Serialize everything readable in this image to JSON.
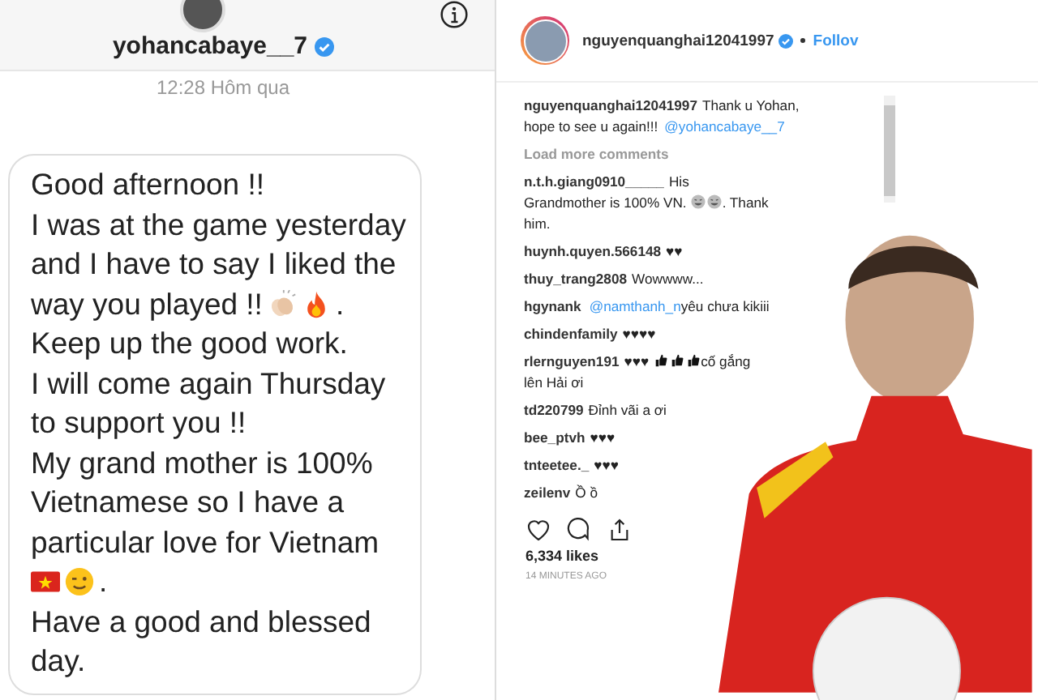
{
  "dm": {
    "username": "yohancabaye__7",
    "verified": true,
    "time": "12:28 Hôm qua",
    "message_lines": [
      [
        {
          "kind": "text",
          "text": "Good afternoon !!"
        }
      ],
      [
        {
          "kind": "text",
          "text": "I was at the game yesterday"
        }
      ],
      [
        {
          "kind": "text",
          "text": "and I have to say I liked the"
        }
      ],
      [
        {
          "kind": "text",
          "text": "way you played !!"
        },
        {
          "kind": "clap"
        },
        {
          "kind": "fire"
        },
        {
          "kind": "text",
          "text": "."
        }
      ],
      [
        {
          "kind": "text",
          "text": "Keep up the good work."
        }
      ],
      [
        {
          "kind": "text",
          "text": "I will come again Thursday"
        }
      ],
      [
        {
          "kind": "text",
          "text": "to support you !!"
        }
      ],
      [
        {
          "kind": "text",
          "text": "My grand mother is 100%"
        }
      ],
      [
        {
          "kind": "text",
          "text": "Vietnamese so I have a"
        }
      ],
      [
        {
          "kind": "text",
          "text": "particular love for Vietnam"
        }
      ],
      [
        {
          "kind": "flag"
        },
        {
          "kind": "wink"
        },
        {
          "kind": "text",
          "text": "."
        }
      ],
      [
        {
          "kind": "text",
          "text": "Have a good and blessed"
        }
      ],
      [
        {
          "kind": "text",
          "text": "day."
        }
      ]
    ]
  },
  "post": {
    "username": "nguyenquanghai12041997",
    "verified": true,
    "follow": "Follov",
    "comments": [
      {
        "user": "nguyenquanghai12041997",
        "parts": [
          {
            "kind": "text",
            "text": "Thank u Yohan,"
          },
          {
            "kind": "break"
          },
          {
            "kind": "text",
            "text": "hope to see u again!!!"
          },
          {
            "kind": "mention",
            "text": "@yohancabaye__7"
          }
        ]
      },
      {
        "kind": "load",
        "text": "Load more comments"
      },
      {
        "user": "n.t.h.giang0910_____",
        "parts": [
          {
            "kind": "text",
            "text": "His"
          },
          {
            "kind": "break"
          },
          {
            "kind": "text",
            "text": "Grandmother is 100% VN."
          },
          {
            "kind": "laugh"
          },
          {
            "kind": "laugh"
          },
          {
            "kind": "text",
            "text": ". Thank"
          },
          {
            "kind": "break"
          },
          {
            "kind": "text",
            "text": "him."
          }
        ]
      },
      {
        "user": "huynh.quyen.566148",
        "parts": [
          {
            "kind": "text",
            "text": "♥♥"
          }
        ]
      },
      {
        "user": "thuy_trang2808",
        "parts": [
          {
            "kind": "text",
            "text": "Wowwww..."
          }
        ]
      },
      {
        "user": "hgynank",
        "parts": [
          {
            "kind": "mention",
            "text": "@namthanh_n"
          },
          {
            "kind": "text",
            "text": "yêu chưa kikiii"
          }
        ]
      },
      {
        "user": "chindenfamily",
        "parts": [
          {
            "kind": "text",
            "text": "♥♥♥♥"
          }
        ]
      },
      {
        "user": "rlernguyen191",
        "parts": [
          {
            "kind": "text",
            "text": "♥♥♥"
          },
          {
            "kind": "thumb"
          },
          {
            "kind": "thumb"
          },
          {
            "kind": "thumb"
          },
          {
            "kind": "text",
            "text": "cố gắng"
          },
          {
            "kind": "break"
          },
          {
            "kind": "text",
            "text": "lên Hải ơi"
          }
        ]
      },
      {
        "user": "td220799",
        "parts": [
          {
            "kind": "text",
            "text": "Đỉnh vãi a ơi"
          }
        ]
      },
      {
        "user": "bee_ptvh",
        "parts": [
          {
            "kind": "text",
            "text": "♥♥♥"
          }
        ]
      },
      {
        "user": "tnteetee._",
        "parts": [
          {
            "kind": "text",
            "text": "♥♥♥"
          }
        ]
      },
      {
        "user": "zeilenv",
        "parts": [
          {
            "kind": "text",
            "text": "Ồ ồ"
          }
        ]
      }
    ],
    "likes": "6,334 likes",
    "time_ago": "14 MINUTES AGO"
  }
}
